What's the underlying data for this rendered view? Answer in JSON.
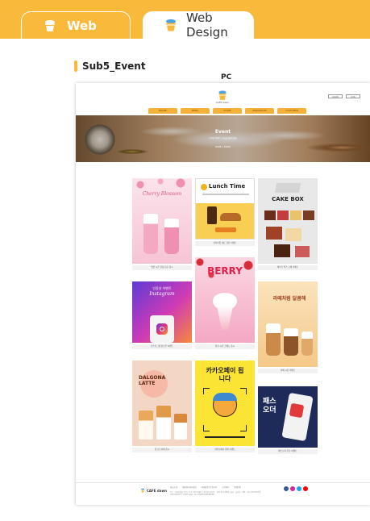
{
  "tabs": [
    {
      "label": "Web"
    },
    {
      "label": "Web Design"
    }
  ],
  "section_title": "Sub5_Event",
  "device_label": "PC",
  "mock": {
    "logo_text": "CAFE dawn",
    "top_buttons": [
      "LOGIN",
      "JOIN"
    ],
    "nav": [
      "BRAND",
      "MENU",
      "STORE",
      "PROMOTION",
      "CUSTOMER"
    ],
    "hero": {
      "title": "Event",
      "subtitle": "다양한 이벤트 소식을 확인하세요",
      "breadcrumb": "HOME > EVENT"
    },
    "cards": [
      {
        "title_text": "Cherry Blossom",
        "caption": "벚꽃 시즌 한정 음료 출시"
      },
      {
        "title_text": "Lunch Time",
        "caption": "런치타임 세트 할인 이벤트"
      },
      {
        "title_text": "CAKE BOX",
        "caption": "케이크 박스 구매 이벤트"
      },
      {
        "title_text": "Instagram",
        "caption": "인스타그램 팔로우 이벤트"
      },
      {
        "title_text": "BERRY",
        "caption": "딸기 시즌 신메뉴 출시"
      },
      {
        "title_text": "라떼처럼 달콤해",
        "caption": "라떼 시즌 이벤트"
      },
      {
        "title_text": "DALGONA LATTE",
        "caption": "달고나 라떼 출시"
      },
      {
        "title_text": "카카오페이 됩니다",
        "caption": "카카오페이 결제 이벤트"
      },
      {
        "title_text": "패스오더",
        "caption": "패스오더 주문 이벤트"
      }
    ],
    "footer": {
      "logo_text": "CAFE dawn",
      "menu": [
        "회사소개",
        "개인정보처리방침",
        "이메일무단수집거부",
        "고객센터",
        "가맹문의"
      ],
      "info": "주소 : 서울특별시 종로구 종로 123 카페던 | 사업자등록번호 : 123-45-67890 | 대표 : 홍길동 | TEL : 02-1234-5678 | COPYRIGHT © CAFE dawn. ALL RIGHTS RESERVED."
    }
  },
  "colors": {
    "accent": "#f9b93a",
    "cherry": "#f7c6d6",
    "lunch": "#f8d15a",
    "insta": "#c43bd1",
    "berry": "#f4a8c4",
    "latte": "#f9d79f",
    "dalgona": "#f0c9b0",
    "kakao": "#fbe434",
    "passorder": "#1e2a5a"
  }
}
